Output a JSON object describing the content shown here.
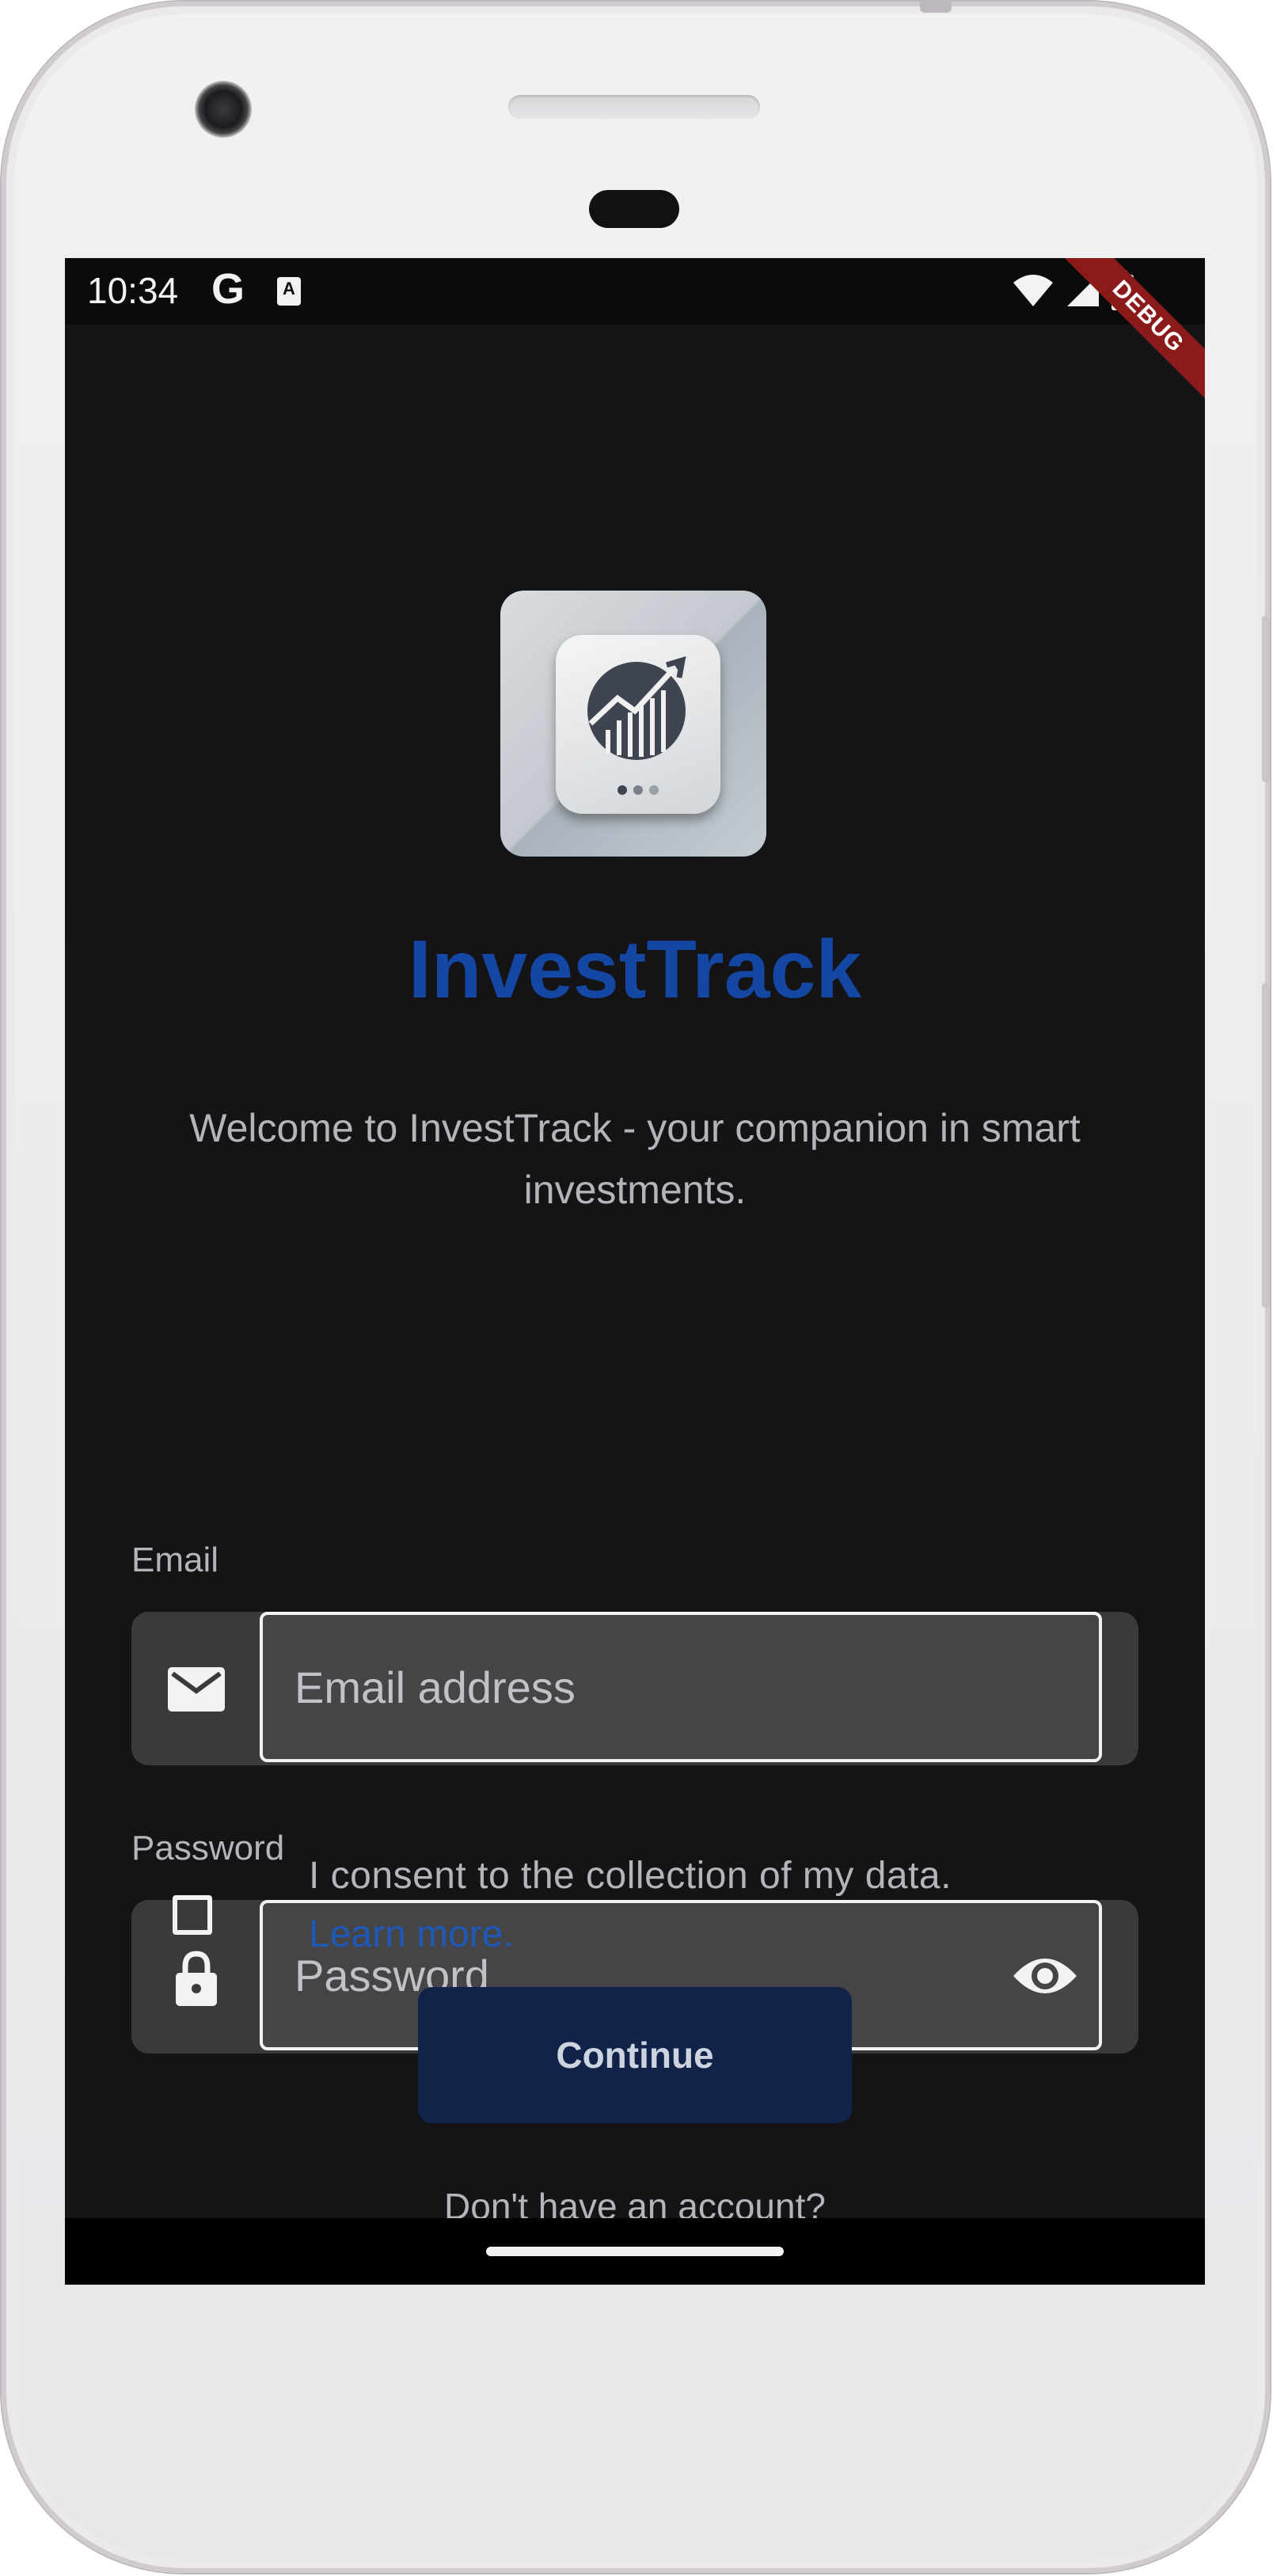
{
  "status_bar": {
    "time": "10:34",
    "google_glyph": "G",
    "accessibility_glyph": "A",
    "icons": [
      "wifi-icon",
      "signal-icon",
      "battery-icon"
    ]
  },
  "debug_banner": "DEBUG",
  "app": {
    "name": "InvestTrack",
    "welcome": "Welcome to InvestTrack - your companion in smart investments.",
    "brand_color": "#1446a3"
  },
  "email": {
    "label": "Email",
    "placeholder": "Email address",
    "icon": "mail-icon"
  },
  "password": {
    "label": "Password",
    "placeholder": "Password",
    "icon": "lock-icon",
    "toggle_icon": "eye-icon"
  },
  "consent": {
    "text": "I consent to the collection of my data.",
    "link": "Learn more.",
    "checked": false
  },
  "continue_label": "Continue",
  "signup_prompt": "Don't have an account?"
}
